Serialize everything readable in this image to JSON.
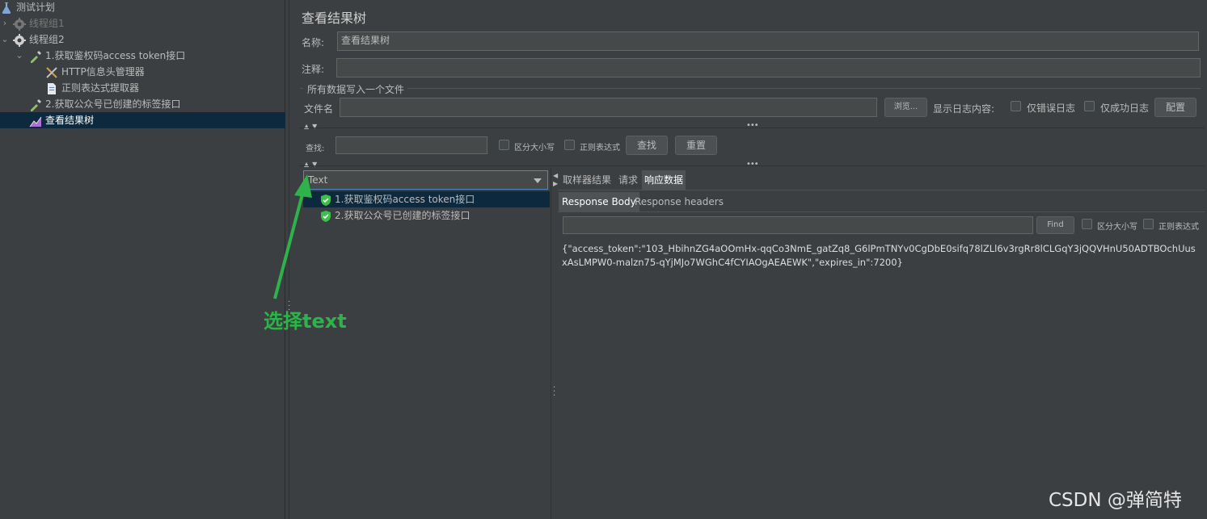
{
  "tree": {
    "root": "测试计划",
    "items": [
      {
        "label": "线程组1",
        "disabled": true
      },
      {
        "label": "线程组2"
      },
      {
        "label": "1.获取鉴权码access token接口"
      },
      {
        "label": "HTTP信息头管理器"
      },
      {
        "label": "正则表达式提取器"
      },
      {
        "label": "2.获取公众号已创建的标签接口"
      },
      {
        "label": "查看结果树",
        "selected": true
      }
    ]
  },
  "panel": {
    "title": "查看结果树",
    "name_label": "名称:",
    "name_value": "查看结果树",
    "comment_label": "注释:",
    "comment_value": "",
    "file_group_label": "所有数据写入一个文件",
    "file_label": "文件名",
    "file_value": "",
    "browse_button": "浏览...",
    "log_content_label": "显示日志内容:",
    "errors_only": "仅错误日志",
    "success_only": "仅成功日志",
    "configure_button": "配置",
    "search_label": "查找:",
    "search_value": "",
    "case_sensitive": "区分大小写",
    "regex": "正则表达式",
    "find_button": "查找",
    "reset_button": "重置"
  },
  "results": {
    "renderer": "Text",
    "samples": [
      {
        "label": "1.获取鉴权码access token接口",
        "selected": true
      },
      {
        "label": "2.获取公众号已创建的标签接口"
      }
    ],
    "tabs": [
      "取样器结果",
      "请求",
      "响应数据"
    ],
    "active_tab": "响应数据",
    "subtabs": [
      "Response Body",
      "Response headers"
    ],
    "active_subtab": "Response Body",
    "find_value": "",
    "find_button": "Find",
    "case_sensitive": "区分大小写",
    "regex": "正则表达式",
    "response_body": "{\"access_token\":\"103_HbihnZG4aOOmHx-qqCo3NmE_gatZq8_G6lPmTNYv0CgDbE0sifq78lZLl6v3rgRr8lCLGqY3jQQVHnU50ADTBOchUusxAsLMPW0-malzn75-qYjMJo7WGhC4fCYIAOgAEAEWK\",\"expires_in\":7200}"
  },
  "annotation": {
    "text": "选择text",
    "color": "#2eb34a"
  },
  "watermark": "CSDN @弹简特",
  "colors": {
    "background": "#3c3f41",
    "selection": "#0d293e",
    "field": "#45494a",
    "success_icon": "#39c24a"
  }
}
